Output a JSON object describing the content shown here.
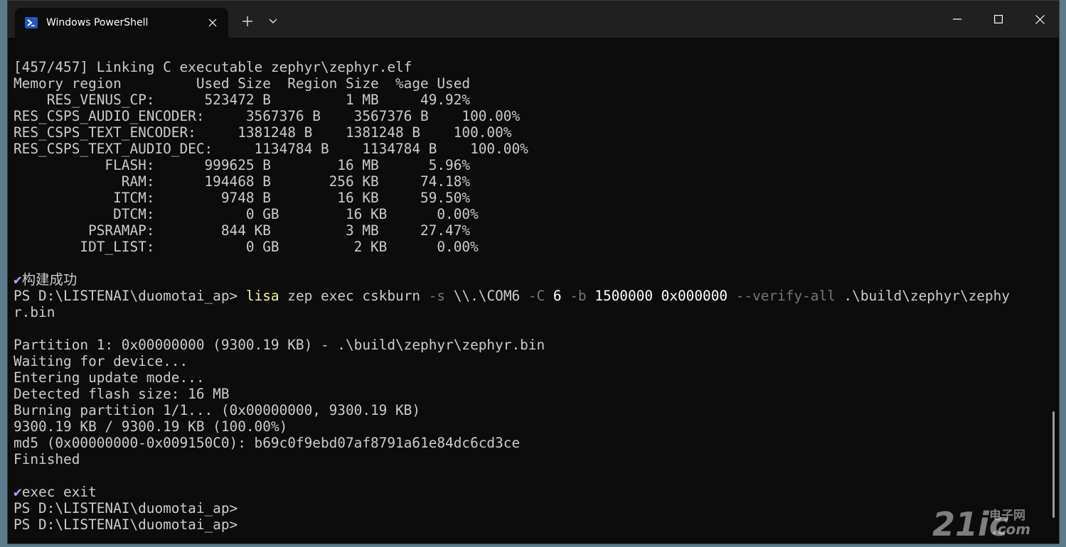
{
  "window": {
    "tab_title": "Windows PowerShell",
    "tab_icon": "powershell-icon",
    "controls": [
      "new-tab-icon",
      "dropdown-chevron-icon",
      "minimize-icon",
      "maximize-icon",
      "close-icon"
    ],
    "colors": {
      "terminal_bg": "#0c0c0c",
      "titlebar_bg": "#202020",
      "text": "#cccccc",
      "command": "#f9f1a5",
      "parameter": "#767676",
      "check": "#b4a0ff"
    }
  },
  "terminal": {
    "lines": [
      [
        {
          "t": "[457/457] Linking C executable zephyr\\zephyr.elf"
        }
      ],
      [
        {
          "t": "Memory region         Used Size  Region Size  %age Used"
        }
      ],
      [
        {
          "t": "    RES_VENUS_CP:      523472 B         1 MB     49.92%"
        }
      ],
      [
        {
          "t": "RES_CSPS_AUDIO_ENCODER:     3567376 B    3567376 B    100.00%"
        }
      ],
      [
        {
          "t": "RES_CSPS_TEXT_ENCODER:     1381248 B    1381248 B    100.00%"
        }
      ],
      [
        {
          "t": "RES_CSPS_TEXT_AUDIO_DEC:     1134784 B    1134784 B    100.00%"
        }
      ],
      [
        {
          "t": "           FLASH:      999625 B        16 MB      5.96%"
        }
      ],
      [
        {
          "t": "             RAM:      194468 B       256 KB     74.18%"
        }
      ],
      [
        {
          "t": "            ITCM:        9748 B        16 KB     59.50%"
        }
      ],
      [
        {
          "t": "            DTCM:           0 GB        16 KB      0.00%"
        }
      ],
      [
        {
          "t": "         PSRAMAP:        844 KB         3 MB     27.47%"
        }
      ],
      [
        {
          "t": "        IDT_LIST:           0 GB         2 KB      0.00%"
        }
      ],
      [],
      [
        {
          "t": "✔",
          "c": "p"
        },
        {
          "t": "构建成功"
        }
      ],
      [
        {
          "t": "PS D:\\LISTENAI\\duomotai_ap> "
        },
        {
          "t": "lisa",
          "c": "y"
        },
        {
          "t": " zep exec cskburn "
        },
        {
          "t": "-s",
          "c": "g"
        },
        {
          "t": " \\\\.\\COM6 "
        },
        {
          "t": "-C",
          "c": "g"
        },
        {
          "t": " 6 ",
          "c": "w"
        },
        {
          "t": "-b",
          "c": "g"
        },
        {
          "t": " 1500000 0x000000 ",
          "c": "w"
        },
        {
          "t": "--verify-all",
          "c": "g"
        },
        {
          "t": " .\\build\\zephyr\\zephy"
        }
      ],
      [
        {
          "t": "r.bin"
        }
      ],
      [],
      [
        {
          "t": "Partition 1: 0x00000000 (9300.19 KB) - .\\build\\zephyr\\zephyr.bin"
        }
      ],
      [
        {
          "t": "Waiting for device..."
        }
      ],
      [
        {
          "t": "Entering update mode..."
        }
      ],
      [
        {
          "t": "Detected flash size: 16 MB"
        }
      ],
      [
        {
          "t": "Burning partition 1/1... (0x00000000, 9300.19 KB)"
        }
      ],
      [
        {
          "t": "9300.19 KB / 9300.19 KB (100.00%)"
        }
      ],
      [
        {
          "t": "md5 (0x00000000-0x009150C0): b69c0f9ebd07af8791a61e84dc6cd3ce"
        }
      ],
      [
        {
          "t": "Finished"
        }
      ],
      [],
      [
        {
          "t": "✔",
          "c": "p"
        },
        {
          "t": "exec exit"
        }
      ],
      [
        {
          "t": "PS D:\\LISTENAI\\duomotai_ap>"
        }
      ],
      [
        {
          "t": "PS D:\\LISTENAI\\duomotai_ap>"
        }
      ]
    ]
  },
  "watermark": {
    "big": "21ic",
    "cn": "电子网",
    "com": ".com"
  }
}
